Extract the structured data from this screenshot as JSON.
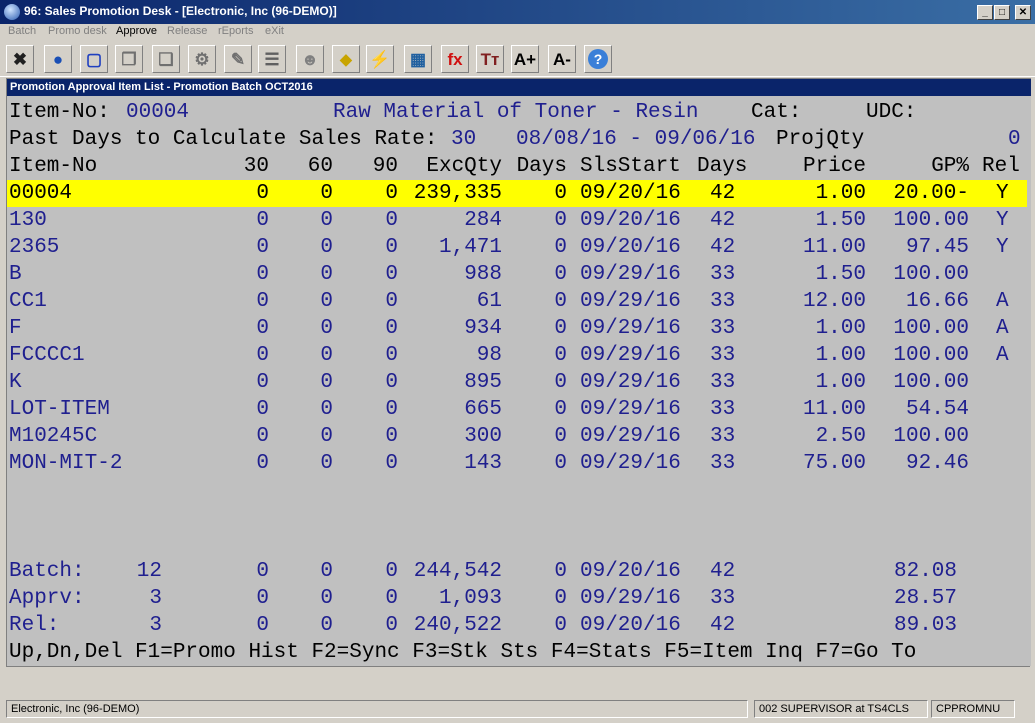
{
  "window": {
    "title": "96: Sales Promotion Desk - [Electronic, Inc (96-DEMO)]",
    "min": "_",
    "max": "□",
    "close": "✕"
  },
  "menu": [
    "Batch",
    "Promo desk",
    "Approve",
    "Release",
    "rEports",
    "eXit"
  ],
  "toolbar": [
    {
      "name": "close-tool-icon",
      "glyph": "✖",
      "color": "#202020"
    },
    {
      "name": "globe-icon",
      "glyph": "●",
      "color": "#1a4fb5"
    },
    {
      "name": "select-icon",
      "glyph": "▢",
      "color": "#2040c0"
    },
    {
      "name": "copy-icon",
      "glyph": "❐",
      "color": "#707070"
    },
    {
      "name": "paste-icon",
      "glyph": "❑",
      "color": "#707070"
    },
    {
      "name": "settings-icon",
      "glyph": "⚙",
      "color": "#707070"
    },
    {
      "name": "edit-icon",
      "glyph": "✎",
      "color": "#707070"
    },
    {
      "name": "list-icon",
      "glyph": "☰",
      "color": "#606060"
    },
    {
      "name": "users-icon",
      "glyph": "☻",
      "color": "#808080"
    },
    {
      "name": "tag-icon",
      "glyph": "⬥",
      "color": "#c8a400"
    },
    {
      "name": "lightning-icon",
      "glyph": "⚡",
      "color": "#505050"
    },
    {
      "name": "calendar-icon",
      "glyph": "▦",
      "color": "#2060a0"
    },
    {
      "name": "function-icon",
      "glyph": "fx",
      "color": "#d01010"
    },
    {
      "name": "font-icon",
      "glyph": "Tт",
      "color": "#802020"
    },
    {
      "name": "font-larger-icon",
      "glyph": "A+",
      "color": "#000000"
    },
    {
      "name": "font-smaller-icon",
      "glyph": "A-",
      "color": "#000000"
    },
    {
      "name": "help-icon",
      "glyph": "?",
      "color": "#ffffff"
    }
  ],
  "screen": {
    "title": "Promotion Approval Item List - Promotion Batch OCT2016",
    "item_line": {
      "label": "Item-No:",
      "item_no": "00004",
      "description": "Raw Material of Toner - Resin",
      "cat_label": "Cat:",
      "udc_label": "UDC:"
    },
    "days_line": {
      "label": "Past Days to Calculate Sales Rate:",
      "days": "30",
      "range": "08/08/16 - 09/06/16",
      "projqty_label": "ProjQty",
      "projqty": "0"
    },
    "headers": [
      "Item-No",
      "30",
      "60",
      "90",
      "ExcQty",
      "Days",
      "SlsStart",
      "Days",
      "Price",
      "GP%",
      "Rel"
    ],
    "rows": [
      {
        "item": "00004",
        "d30": "0",
        "d60": "0",
        "d90": "0",
        "exc": "239,335",
        "days": "0",
        "start": "09/20/16",
        "days2": "42",
        "price": "1.00",
        "gp": "20.00-",
        "rel": "Y",
        "selected": true
      },
      {
        "item": "130",
        "d30": "0",
        "d60": "0",
        "d90": "0",
        "exc": "284",
        "days": "0",
        "start": "09/20/16",
        "days2": "42",
        "price": "1.50",
        "gp": "100.00",
        "rel": "Y"
      },
      {
        "item": "2365",
        "d30": "0",
        "d60": "0",
        "d90": "0",
        "exc": "1,471",
        "days": "0",
        "start": "09/20/16",
        "days2": "42",
        "price": "11.00",
        "gp": "97.45",
        "rel": "Y"
      },
      {
        "item": "B",
        "d30": "0",
        "d60": "0",
        "d90": "0",
        "exc": "988",
        "days": "0",
        "start": "09/29/16",
        "days2": "33",
        "price": "1.50",
        "gp": "100.00",
        "rel": ""
      },
      {
        "item": "CC1",
        "d30": "0",
        "d60": "0",
        "d90": "0",
        "exc": "61",
        "days": "0",
        "start": "09/29/16",
        "days2": "33",
        "price": "12.00",
        "gp": "16.66",
        "rel": "A"
      },
      {
        "item": "F",
        "d30": "0",
        "d60": "0",
        "d90": "0",
        "exc": "934",
        "days": "0",
        "start": "09/29/16",
        "days2": "33",
        "price": "1.00",
        "gp": "100.00",
        "rel": "A"
      },
      {
        "item": "FCCCC1",
        "d30": "0",
        "d60": "0",
        "d90": "0",
        "exc": "98",
        "days": "0",
        "start": "09/29/16",
        "days2": "33",
        "price": "1.00",
        "gp": "100.00",
        "rel": "A"
      },
      {
        "item": "K",
        "d30": "0",
        "d60": "0",
        "d90": "0",
        "exc": "895",
        "days": "0",
        "start": "09/29/16",
        "days2": "33",
        "price": "1.00",
        "gp": "100.00",
        "rel": ""
      },
      {
        "item": "LOT-ITEM",
        "d30": "0",
        "d60": "0",
        "d90": "0",
        "exc": "665",
        "days": "0",
        "start": "09/29/16",
        "days2": "33",
        "price": "11.00",
        "gp": "54.54",
        "rel": ""
      },
      {
        "item": "M10245C",
        "d30": "0",
        "d60": "0",
        "d90": "0",
        "exc": "300",
        "days": "0",
        "start": "09/29/16",
        "days2": "33",
        "price": "2.50",
        "gp": "100.00",
        "rel": ""
      },
      {
        "item": "MON-MIT-2",
        "d30": "0",
        "d60": "0",
        "d90": "0",
        "exc": "143",
        "days": "0",
        "start": "09/29/16",
        "days2": "33",
        "price": "75.00",
        "gp": "92.46",
        "rel": ""
      }
    ],
    "totals": [
      {
        "label": "Batch:",
        "count": "12",
        "d30": "0",
        "d60": "0",
        "d90": "0",
        "exc": "244,542",
        "days": "0",
        "start": "09/20/16",
        "days2": "42",
        "gp": "82.08"
      },
      {
        "label": "Apprv:",
        "count": "3",
        "d30": "0",
        "d60": "0",
        "d90": "0",
        "exc": "1,093",
        "days": "0",
        "start": "09/29/16",
        "days2": "33",
        "gp": "28.57"
      },
      {
        "label": "Rel:",
        "count": "3",
        "d30": "0",
        "d60": "0",
        "d90": "0",
        "exc": "240,522",
        "days": "0",
        "start": "09/20/16",
        "days2": "42",
        "gp": "89.03"
      }
    ],
    "keys": "Up,Dn,Del F1=Promo Hist F2=Sync F3=Stk Sts F4=Stats F5=Item Inq F7=Go To"
  },
  "status": {
    "company": "Electronic, Inc (96-DEMO)",
    "user": "002 SUPERVISOR at TS4CLS",
    "program": "CPPROMNU"
  }
}
